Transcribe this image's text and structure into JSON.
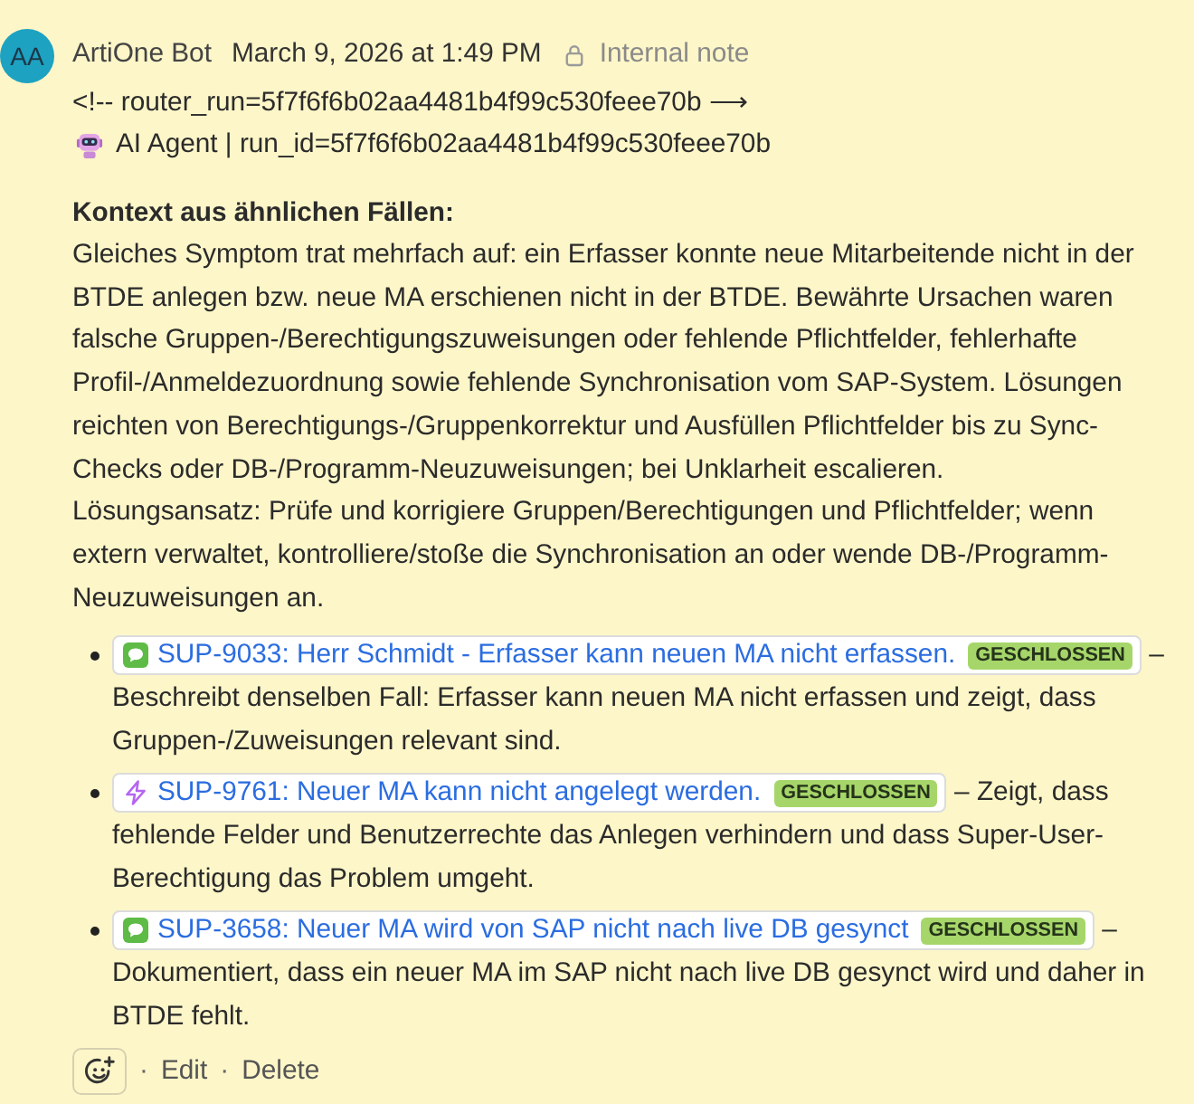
{
  "note": {
    "avatar": {
      "initials": "AA"
    },
    "author": "ArtiOne Bot",
    "timestamp": "March 9, 2026 at 1:49 PM",
    "visibility": {
      "kind": "internal",
      "label": "Internal note"
    }
  },
  "meta_lines": [
    {
      "kind": "comment",
      "text": "<!-- router_run=5f7f6f6b02aa4481b4f99c530feee70b ⟶"
    },
    {
      "kind": "agent",
      "text": "AI Agent | run_id=5f7f6f6b02aa4481b4f99c530feee70b"
    }
  ],
  "context": {
    "heading": "Kontext aus ähnlichen Fällen:",
    "paragraphs": [
      "Gleiches Symptom trat mehrfach auf: ein Erfasser konnte neue Mitarbeitende nicht in der BTDE anlegen bzw. neue MA erschienen nicht in der BTDE. Bewährte Ursachen waren falsche Gruppen-/Berechtigungszuweisungen oder fehlende Pflichtfelder, fehlerhafte Profil-/Anmeldezuordnung sowie fehlende Synchronisation vom SAP-System. Lösungen reichten von Berechtigungs-/Gruppenkorrektur und Ausfüllen Pflichtfelder bis zu Sync-Checks oder DB-/Programm-Neuzuweisungen; bei Unklarheit escalieren.",
      "Lösungsansatz: Prüfe und korrigiere Gruppen/Berechtigungen und Pflichtfelder; wenn extern verwaltet, kontrolliere/stoße die Synchronisation an oder wende DB-/Programm-Neuzuweisungen an."
    ]
  },
  "related_tickets": [
    {
      "kind": "chat",
      "title": "SUP-9033: Herr Schmidt - Erfasser kann neuen MA nicht erfassen.",
      "status": "GESCHLOSSEN",
      "description": "– Beschreibt denselben Fall: Erfasser kann neuen MA nicht erfassen und zeigt, dass Gruppen-/Zuweisungen relevant sind."
    },
    {
      "kind": "bolt",
      "title": "SUP-9761: Neuer MA kann nicht angelegt werden.",
      "status": "GESCHLOSSEN",
      "description": "– Zeigt, dass fehlende Felder und Benutzerrechte das Anlegen verhindern und dass Super-User-Berechtigung das Problem umgeht."
    },
    {
      "kind": "chat",
      "title": "SUP-3658: Neuer MA wird von SAP nicht nach live DB gesynct",
      "status": "GESCHLOSSEN",
      "description": "– Dokumentiert, dass ein neuer MA im SAP nicht nach live DB gesynct wird und daher in BTDE fehlt."
    }
  ],
  "footer": {
    "actions": [
      {
        "separator": "·",
        "label": "Edit"
      },
      {
        "separator": "·",
        "label": "Delete"
      }
    ]
  }
}
